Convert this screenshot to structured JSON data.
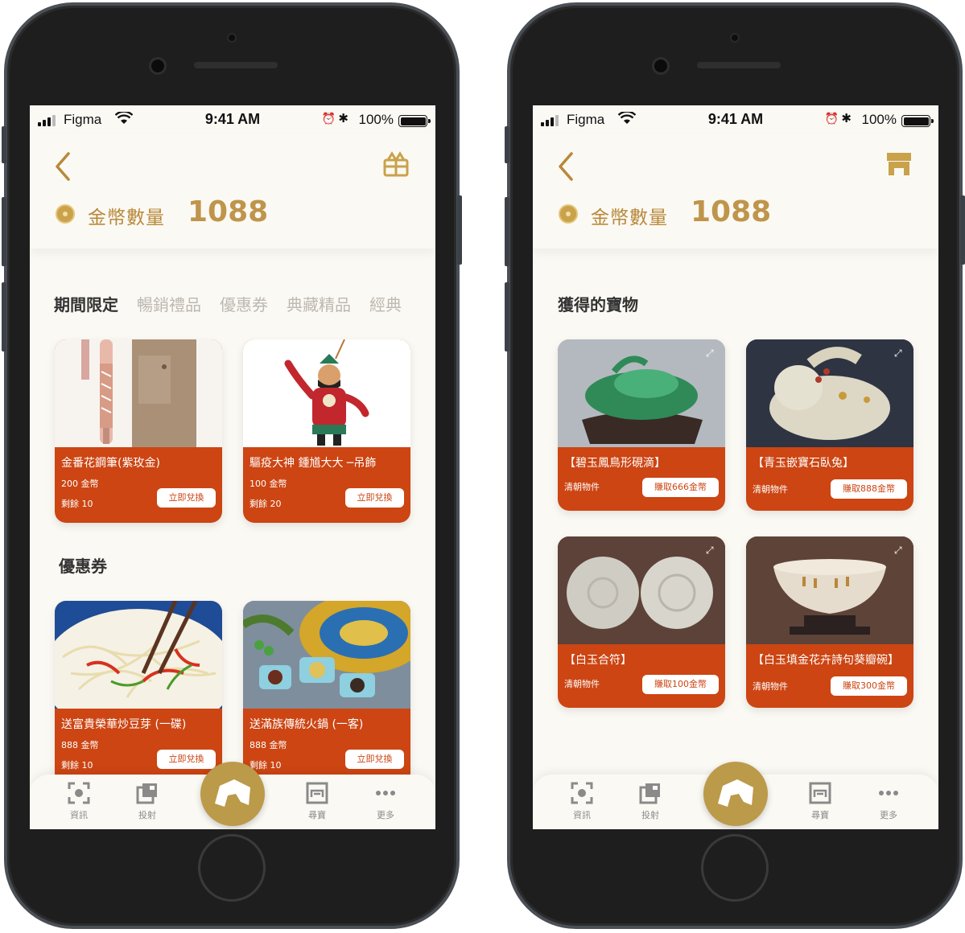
{
  "colors": {
    "accent": "#bb9a4a",
    "card": "#cc4513",
    "background": "#fbf9f4"
  },
  "status_bar": {
    "carrier": "Figma",
    "time": "9:41 AM",
    "battery": "100%"
  },
  "left": {
    "header": {
      "coin_label": "金幣數量",
      "coin_count": "1088",
      "icon": "gift-box-icon"
    },
    "tabs": [
      "期間限定",
      "暢銷禮品",
      "優惠券",
      "典藏精品",
      "經典"
    ],
    "section2_title": "優惠券",
    "cards": [
      {
        "name": "金番花鋼筆(紫玫金)",
        "price": "200 金幣",
        "remaining": "剩餘 10",
        "button": "立即兌換"
      },
      {
        "name": "驅疫大神 鍾馗大大 ─吊飾",
        "price": "100 金幣",
        "remaining": "剩餘 20",
        "button": "立即兌換"
      },
      {
        "name": "送富貴榮華炒豆芽 (一碟)",
        "price": "888 金幣",
        "remaining": "剩餘 10",
        "button": "立即兌換"
      },
      {
        "name": "送滿族傳統火鍋 (一客)",
        "price": "888 金幣",
        "remaining": "剩餘 10",
        "button": "立即兌換"
      }
    ]
  },
  "right": {
    "header": {
      "coin_label": "金幣數量",
      "coin_count": "1088",
      "icon": "shop-icon"
    },
    "section_title": "獲得的寶物",
    "cards": [
      {
        "name": "【碧玉鳳鳥形硯滴】",
        "era": "清朝物件",
        "button": "賺取666金幣"
      },
      {
        "name": "【青玉嵌寶石臥兔】",
        "era": "清朝物件",
        "button": "賺取888金幣"
      },
      {
        "name": "【白玉合符】",
        "era": "清朝物件",
        "button": "賺取100金幣"
      },
      {
        "name": "【白玉填金花卉詩句葵瓣碗】",
        "era": "清朝物件",
        "button": "賺取300金幣"
      }
    ]
  },
  "tabbar": {
    "items": [
      {
        "label": "資訊",
        "icon": "scan-icon"
      },
      {
        "label": "投射",
        "icon": "cast-icon"
      },
      {
        "label": "",
        "icon": "home-icon"
      },
      {
        "label": "尋寶",
        "icon": "treasure-icon"
      },
      {
        "label": "更多",
        "icon": "more-icon"
      }
    ]
  }
}
